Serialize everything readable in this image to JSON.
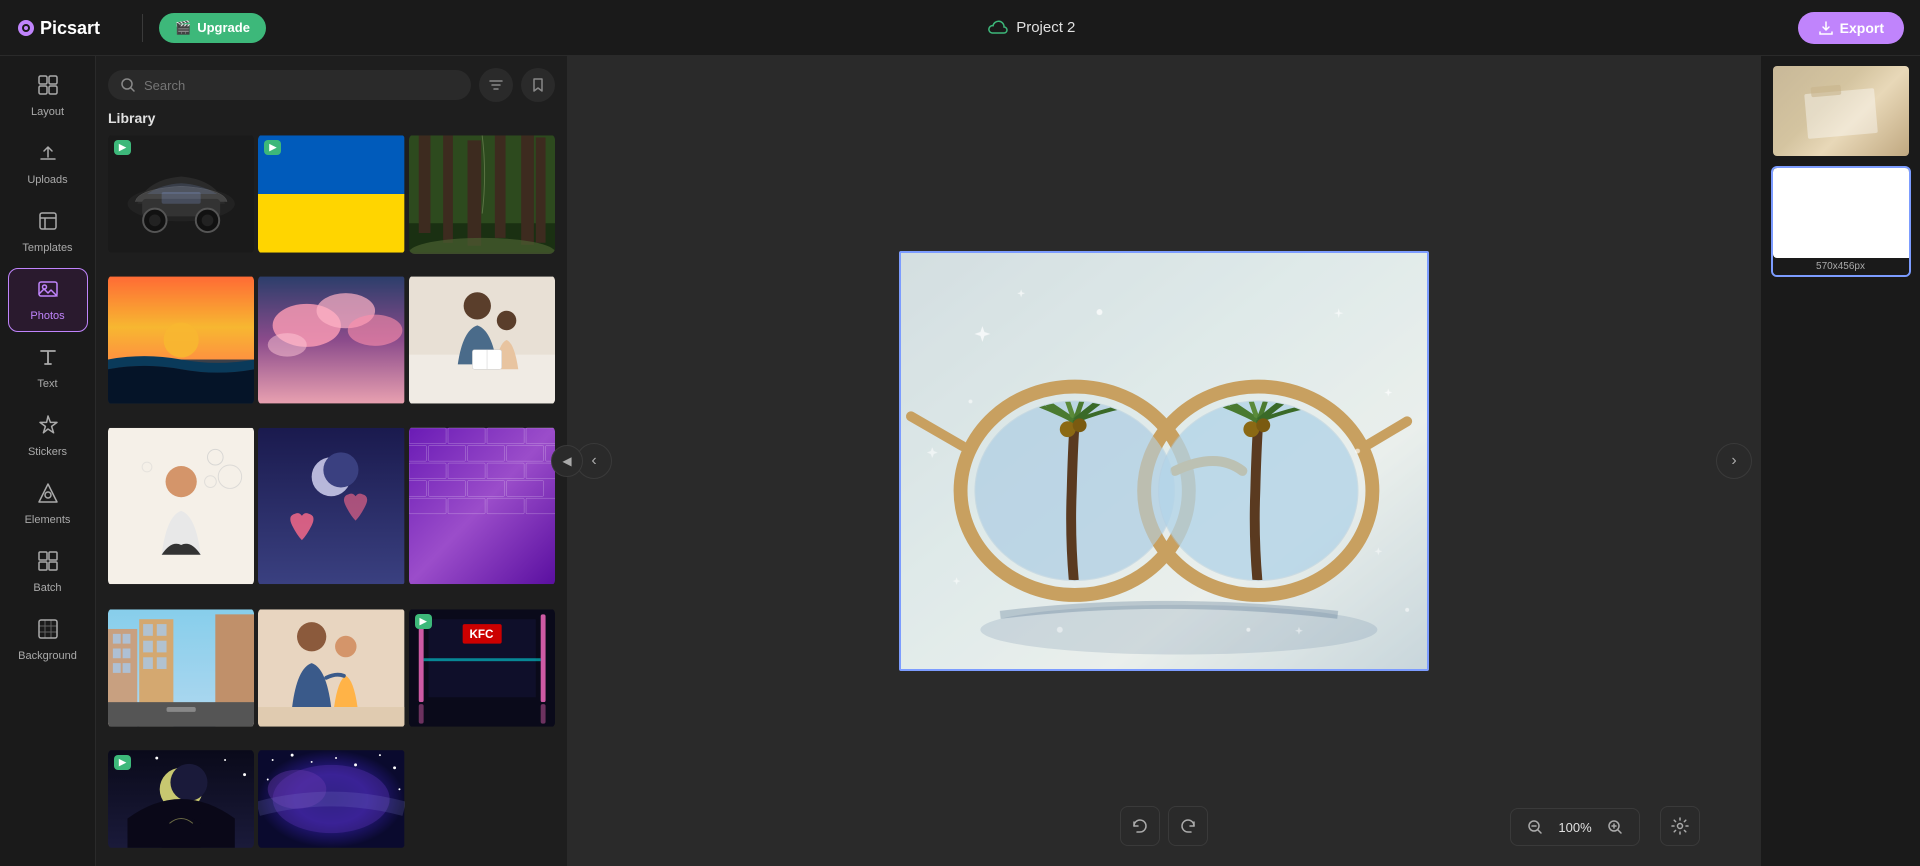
{
  "header": {
    "logo": "Picsart",
    "upgrade_label": "Upgrade",
    "project_title": "Project 2",
    "export_label": "Export"
  },
  "sidebar": {
    "items": [
      {
        "id": "layout",
        "label": "Layout",
        "icon": "▦"
      },
      {
        "id": "uploads",
        "label": "Uploads",
        "icon": "↑"
      },
      {
        "id": "templates",
        "label": "Templates",
        "icon": "📖"
      },
      {
        "id": "photos",
        "label": "Photos",
        "icon": "🖼",
        "active": true
      },
      {
        "id": "text",
        "label": "Text",
        "icon": "T"
      },
      {
        "id": "stickers",
        "label": "Stickers",
        "icon": "★"
      },
      {
        "id": "elements",
        "label": "Elements",
        "icon": "◇"
      },
      {
        "id": "batch",
        "label": "Batch",
        "icon": "⊞"
      },
      {
        "id": "background",
        "label": "Background",
        "icon": "▧"
      }
    ]
  },
  "panel": {
    "search_placeholder": "Search",
    "library_label": "Library",
    "filter_icon": "filter",
    "bookmark_icon": "bookmark"
  },
  "canvas": {
    "image_description": "Sunglasses with palm tree reflection on white sandy surface",
    "border_color": "#7c9cff"
  },
  "zoom": {
    "value": "100%",
    "minus_label": "−",
    "plus_label": "+"
  },
  "thumbnails": [
    {
      "id": "thumb1",
      "label": "",
      "active": false
    },
    {
      "id": "thumb2",
      "label": "570x456px",
      "active": true
    }
  ],
  "colors": {
    "accent_purple": "#c084fc",
    "accent_green": "#3db87a",
    "canvas_border": "#7c9cff",
    "bg_dark": "#1a1a1a",
    "bg_panel": "#1e1e1e"
  }
}
